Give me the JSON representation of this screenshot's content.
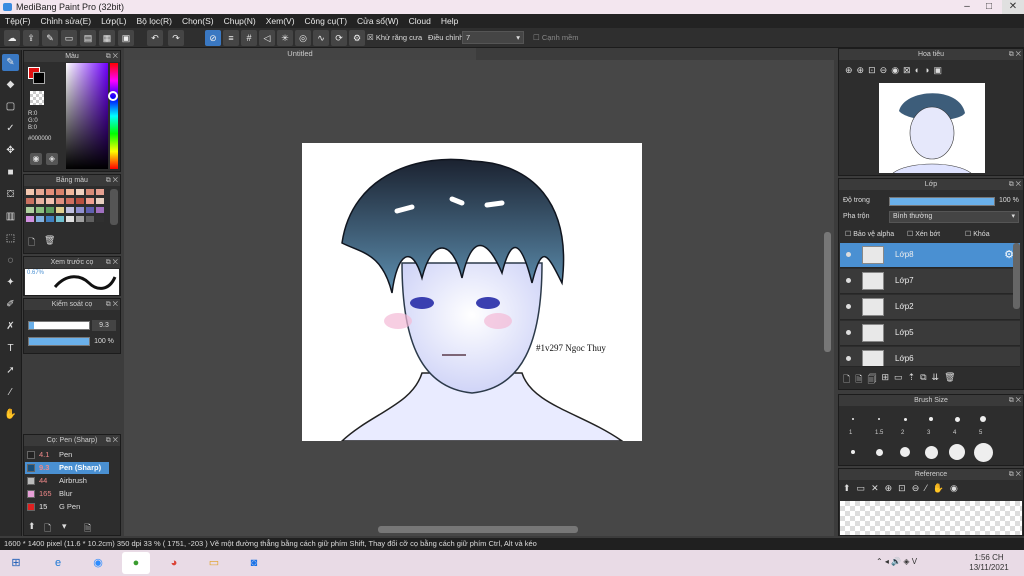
{
  "window": {
    "title": "MediBang Paint Pro (32bit)"
  },
  "menu": [
    "Tệp(F)",
    "Chỉnh sửa(E)",
    "Lớp(L)",
    "Bộ lọc(R)",
    "Chọn(S)",
    "Chụp(N)",
    "Xem(V)",
    "Công cụ(T)",
    "Cửa sổ(W)",
    "Cloud",
    "Help"
  ],
  "toolbar": {
    "antialias_label": "Khử răng cưa",
    "adjust_label": "Điều chỉnh",
    "adjust_value": "7",
    "snap_label": "Cạnh mềm"
  },
  "color_panel": {
    "title": "Màu",
    "r": "R:0",
    "g": "G:0",
    "b": "B:0",
    "hex": "#000000"
  },
  "palette_panel": {
    "title": "Bảng màu"
  },
  "brush_preview_panel": {
    "title": "Xem trước cọ",
    "size": "0.67%"
  },
  "brush_control_panel": {
    "title": "Kiểm soát cọ",
    "size_value": "9.3",
    "opacity_value": "100 %"
  },
  "brush_list_panel": {
    "title": "Cọ: Pen (Sharp)",
    "items": [
      {
        "size": "4.1",
        "name": "Pen",
        "color": "#222222"
      },
      {
        "size": "9.3",
        "name": "Pen (Sharp)",
        "color": "#1a4f7a"
      },
      {
        "size": "44",
        "name": "Airbrush",
        "color": "#bbbbbb"
      },
      {
        "size": "165",
        "name": "Blur",
        "color": "#e7a0d8"
      },
      {
        "size": "15",
        "name": "G Pen",
        "color": "#e02020"
      }
    ]
  },
  "document": {
    "tab": "Untitled",
    "signature": "#1v297 Ngoc Thuy"
  },
  "navigator_panel": {
    "title": "Hoa tiêu"
  },
  "layer_panel": {
    "title": "Lớp",
    "opacity_label": "Độ trong",
    "opacity_value": "100 %",
    "blend_label": "Pha trộn",
    "blend_value": "Bình thường",
    "alpha_protect": "Bảo vệ alpha",
    "clipping": "Xén bớt",
    "lock": "Khóa",
    "layers": [
      {
        "name": "Lớp8"
      },
      {
        "name": "Lớp7"
      },
      {
        "name": "Lớp2"
      },
      {
        "name": "Lớp5"
      },
      {
        "name": "Lớp6"
      }
    ]
  },
  "brush_size_panel": {
    "title": "Brush Size",
    "sizes": [
      "1",
      "1.5",
      "2",
      "3",
      "4",
      "5"
    ]
  },
  "reference_panel": {
    "title": "Reference"
  },
  "statusbar": {
    "text": "1600 * 1400 pixel   (11.6 * 10.2cm)   350 dpi   33 %   ( 1751, -203 )   Vẽ một đường thẳng bằng cách giữ phím Shift, Thay đổi cỡ cọ bằng cách giữ phím Ctrl, Alt và kéo"
  },
  "taskbar": {
    "time": "1:56 CH",
    "date": "13/11/2021"
  },
  "colors": {
    "accent": "#4a90d2",
    "panel": "#2d2d2d",
    "canvas_bg": "#474747"
  }
}
